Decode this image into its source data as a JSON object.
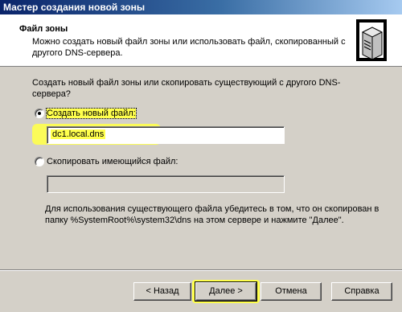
{
  "window": {
    "title": "Мастер создания новой зоны"
  },
  "header": {
    "title": "Файл зоны",
    "description": "Можно создать новый файл зоны или использовать файл, скопированный с другого DNS-сервера.",
    "icon": "server-icon"
  },
  "main": {
    "question": "Создать новый файл зоны или скопировать существующий с другого DNS-сервера?",
    "options": [
      {
        "label": "Создать новый файл:",
        "selected": true,
        "value": "dc1.local.dns"
      },
      {
        "label": "Скопировать имеющийся файл:",
        "selected": false,
        "value": ""
      }
    ],
    "hint": "Для использования существующего файла убедитесь в том, что он скопирован в папку %SystemRoot%\\system32\\dns на этом сервере и нажмите \"Далее\"."
  },
  "buttons": {
    "back": "< Назад",
    "next": "Далее >",
    "cancel": "Отмена",
    "help": "Справка"
  },
  "colors": {
    "highlight": "#ffff4d",
    "titlebar": "#0a246a",
    "dialog": "#d4d0c8"
  }
}
